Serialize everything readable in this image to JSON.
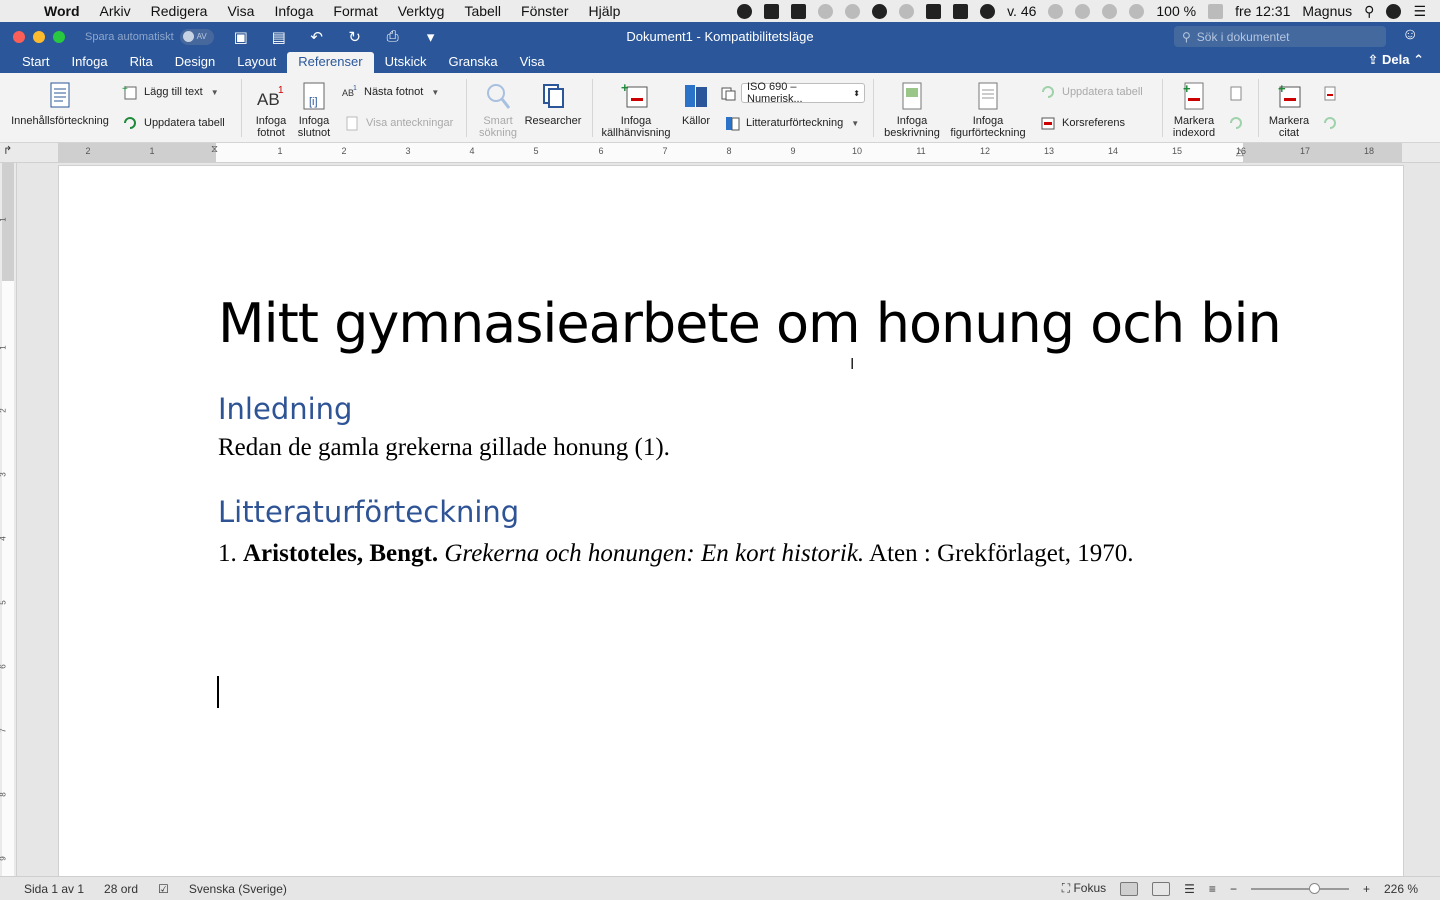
{
  "menubar": {
    "app": "Word",
    "items": [
      "Arkiv",
      "Redigera",
      "Visa",
      "Infoga",
      "Format",
      "Verktyg",
      "Tabell",
      "Fönster",
      "Hjälp"
    ],
    "week": "v. 46",
    "battery": "100 %",
    "clock": "fre 12:31",
    "user": "Magnus"
  },
  "titlebar": {
    "autosave_label": "Spara automatiskt",
    "autosave_state": "AV",
    "title": "Dokument1  -  Kompatibilitetsläge",
    "search_placeholder": "Sök i dokumentet"
  },
  "tabs": [
    "Start",
    "Infoga",
    "Rita",
    "Design",
    "Layout",
    "Referenser",
    "Utskick",
    "Granska",
    "Visa"
  ],
  "active_tab": "Referenser",
  "share_label": "Dela",
  "ribbon": {
    "toc": "Innehållsförteckning",
    "add_text": "Lägg till text",
    "update_table": "Uppdatera tabell",
    "insert_footnote": [
      "Infoga",
      "fotnot"
    ],
    "insert_endnote": [
      "Infoga",
      "slutnot"
    ],
    "next_footnote": "Nästa fotnot",
    "show_notes": "Visa anteckningar",
    "smart_search": [
      "Smart",
      "sökning"
    ],
    "researcher": "Researcher",
    "insert_citation": [
      "Infoga",
      "källhänvisning"
    ],
    "sources": "Källor",
    "style_value": "ISO 690 – Numerisk...",
    "bibliography": "Litteraturförteckning",
    "insert_caption": [
      "Infoga",
      "beskrivning"
    ],
    "insert_tof": [
      "Infoga",
      "figurförteckning"
    ],
    "update_table_disabled": "Uppdatera tabell",
    "cross_reference": "Korsreferens",
    "mark_entry": [
      "Markera",
      "indexord"
    ],
    "mark_citation": [
      "Markera",
      "citat"
    ]
  },
  "ruler": {
    "numbers": [
      "2",
      "1",
      "1",
      "2",
      "3",
      "4",
      "5",
      "6",
      "7",
      "8",
      "9",
      "10",
      "11",
      "12",
      "13",
      "14",
      "15",
      "16",
      "17",
      "18"
    ],
    "vnumbers": [
      "1",
      "1",
      "2",
      "3",
      "4",
      "5",
      "6",
      "7",
      "8",
      "9"
    ]
  },
  "document": {
    "title": "Mitt gymnasiearbete om honung och bin",
    "heading1": "Inledning",
    "paragraph1": "Redan de gamla grekerna gillade honung (1).",
    "heading2": "Litteraturförteckning",
    "biblio_num": "1. ",
    "biblio_author": "Aristoteles, Bengt.",
    "biblio_title": "Grekerna och honungen: En kort historik.",
    "biblio_rest": " Aten : Grekförlaget, 1970."
  },
  "status": {
    "page": "Sida 1 av 1",
    "words": "28 ord",
    "language": "Svenska (Sverige)",
    "focus": "Fokus",
    "zoom": "226 %",
    "zoom_value": 226
  },
  "colors": {
    "word_blue": "#2b579a",
    "heading_blue": "#2f5496"
  }
}
